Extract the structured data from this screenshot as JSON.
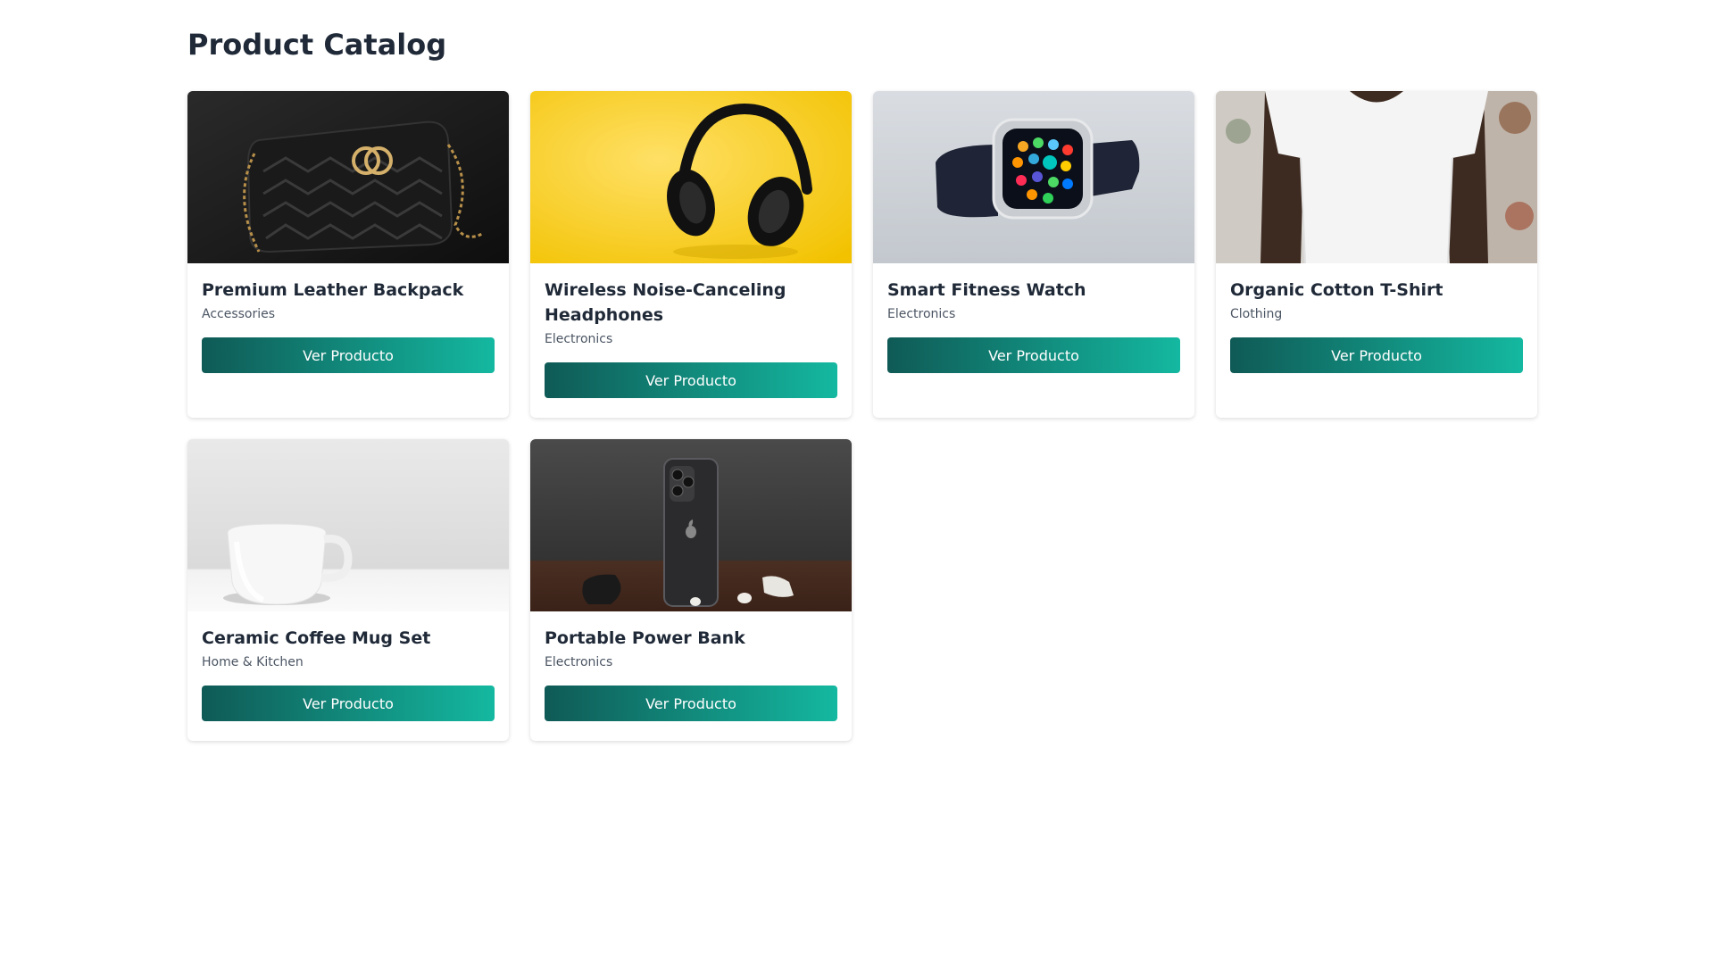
{
  "page": {
    "title": "Product Catalog"
  },
  "colors": {
    "button_gradient_start": "#0f5a56",
    "button_gradient_end": "#14b8a0",
    "title_text": "#1f2937",
    "category_text": "#4b5563"
  },
  "products": [
    {
      "name": "Premium Leather Backpack",
      "category": "Accessories",
      "button_label": "Ver Producto",
      "image": "black-quilted-leather-bag-photo"
    },
    {
      "name": "Wireless Noise-Canceling Headphones",
      "category": "Electronics",
      "button_label": "Ver Producto",
      "image": "black-headphones-on-yellow-photo"
    },
    {
      "name": "Smart Fitness Watch",
      "category": "Electronics",
      "button_label": "Ver Producto",
      "image": "smartwatch-on-grey-photo"
    },
    {
      "name": "Organic Cotton T-Shirt",
      "category": "Clothing",
      "button_label": "Ver Producto",
      "image": "white-tshirt-model-photo"
    },
    {
      "name": "Ceramic Coffee Mug Set",
      "category": "Home & Kitchen",
      "button_label": "Ver Producto",
      "image": "white-ceramic-mug-photo"
    },
    {
      "name": "Portable Power Bank",
      "category": "Electronics",
      "button_label": "Ver Producto",
      "image": "black-smartphone-on-table-photo"
    }
  ]
}
